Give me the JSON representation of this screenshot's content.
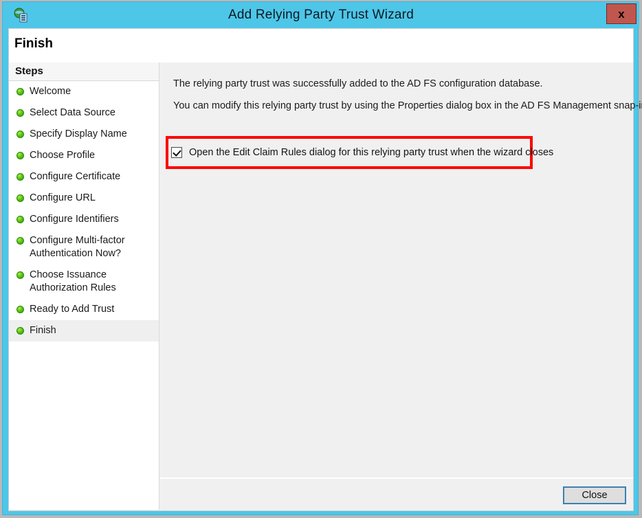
{
  "window": {
    "title": "Add Relying Party Trust Wizard",
    "icon": "adfs-globe-icon",
    "close_label": "x",
    "accent_color": "#4ec6e8",
    "close_button_color": "#c0574f"
  },
  "header": {
    "page_title": "Finish"
  },
  "sidebar": {
    "heading": "Steps",
    "items": [
      {
        "label": "Welcome",
        "state": "complete"
      },
      {
        "label": "Select Data Source",
        "state": "complete"
      },
      {
        "label": "Specify Display Name",
        "state": "complete"
      },
      {
        "label": "Choose Profile",
        "state": "complete"
      },
      {
        "label": "Configure Certificate",
        "state": "complete"
      },
      {
        "label": "Configure URL",
        "state": "complete"
      },
      {
        "label": "Configure Identifiers",
        "state": "complete"
      },
      {
        "label": "Configure Multi-factor Authentication Now?",
        "state": "complete"
      },
      {
        "label": "Choose Issuance Authorization Rules",
        "state": "complete"
      },
      {
        "label": "Ready to Add Trust",
        "state": "complete"
      },
      {
        "label": "Finish",
        "state": "current"
      }
    ],
    "bullet_color": "#5cc516"
  },
  "main": {
    "paragraph_1": "The relying party trust was successfully added to the AD FS configuration database.",
    "paragraph_2": "You can modify this relying party trust by using the Properties dialog box in the AD FS Management snap-in.",
    "checkbox": {
      "label": "Open the Edit Claim Rules dialog for this relying party trust when the wizard closes",
      "checked": true
    },
    "highlight_color": "#fe0000"
  },
  "footer": {
    "close_label": "Close"
  }
}
